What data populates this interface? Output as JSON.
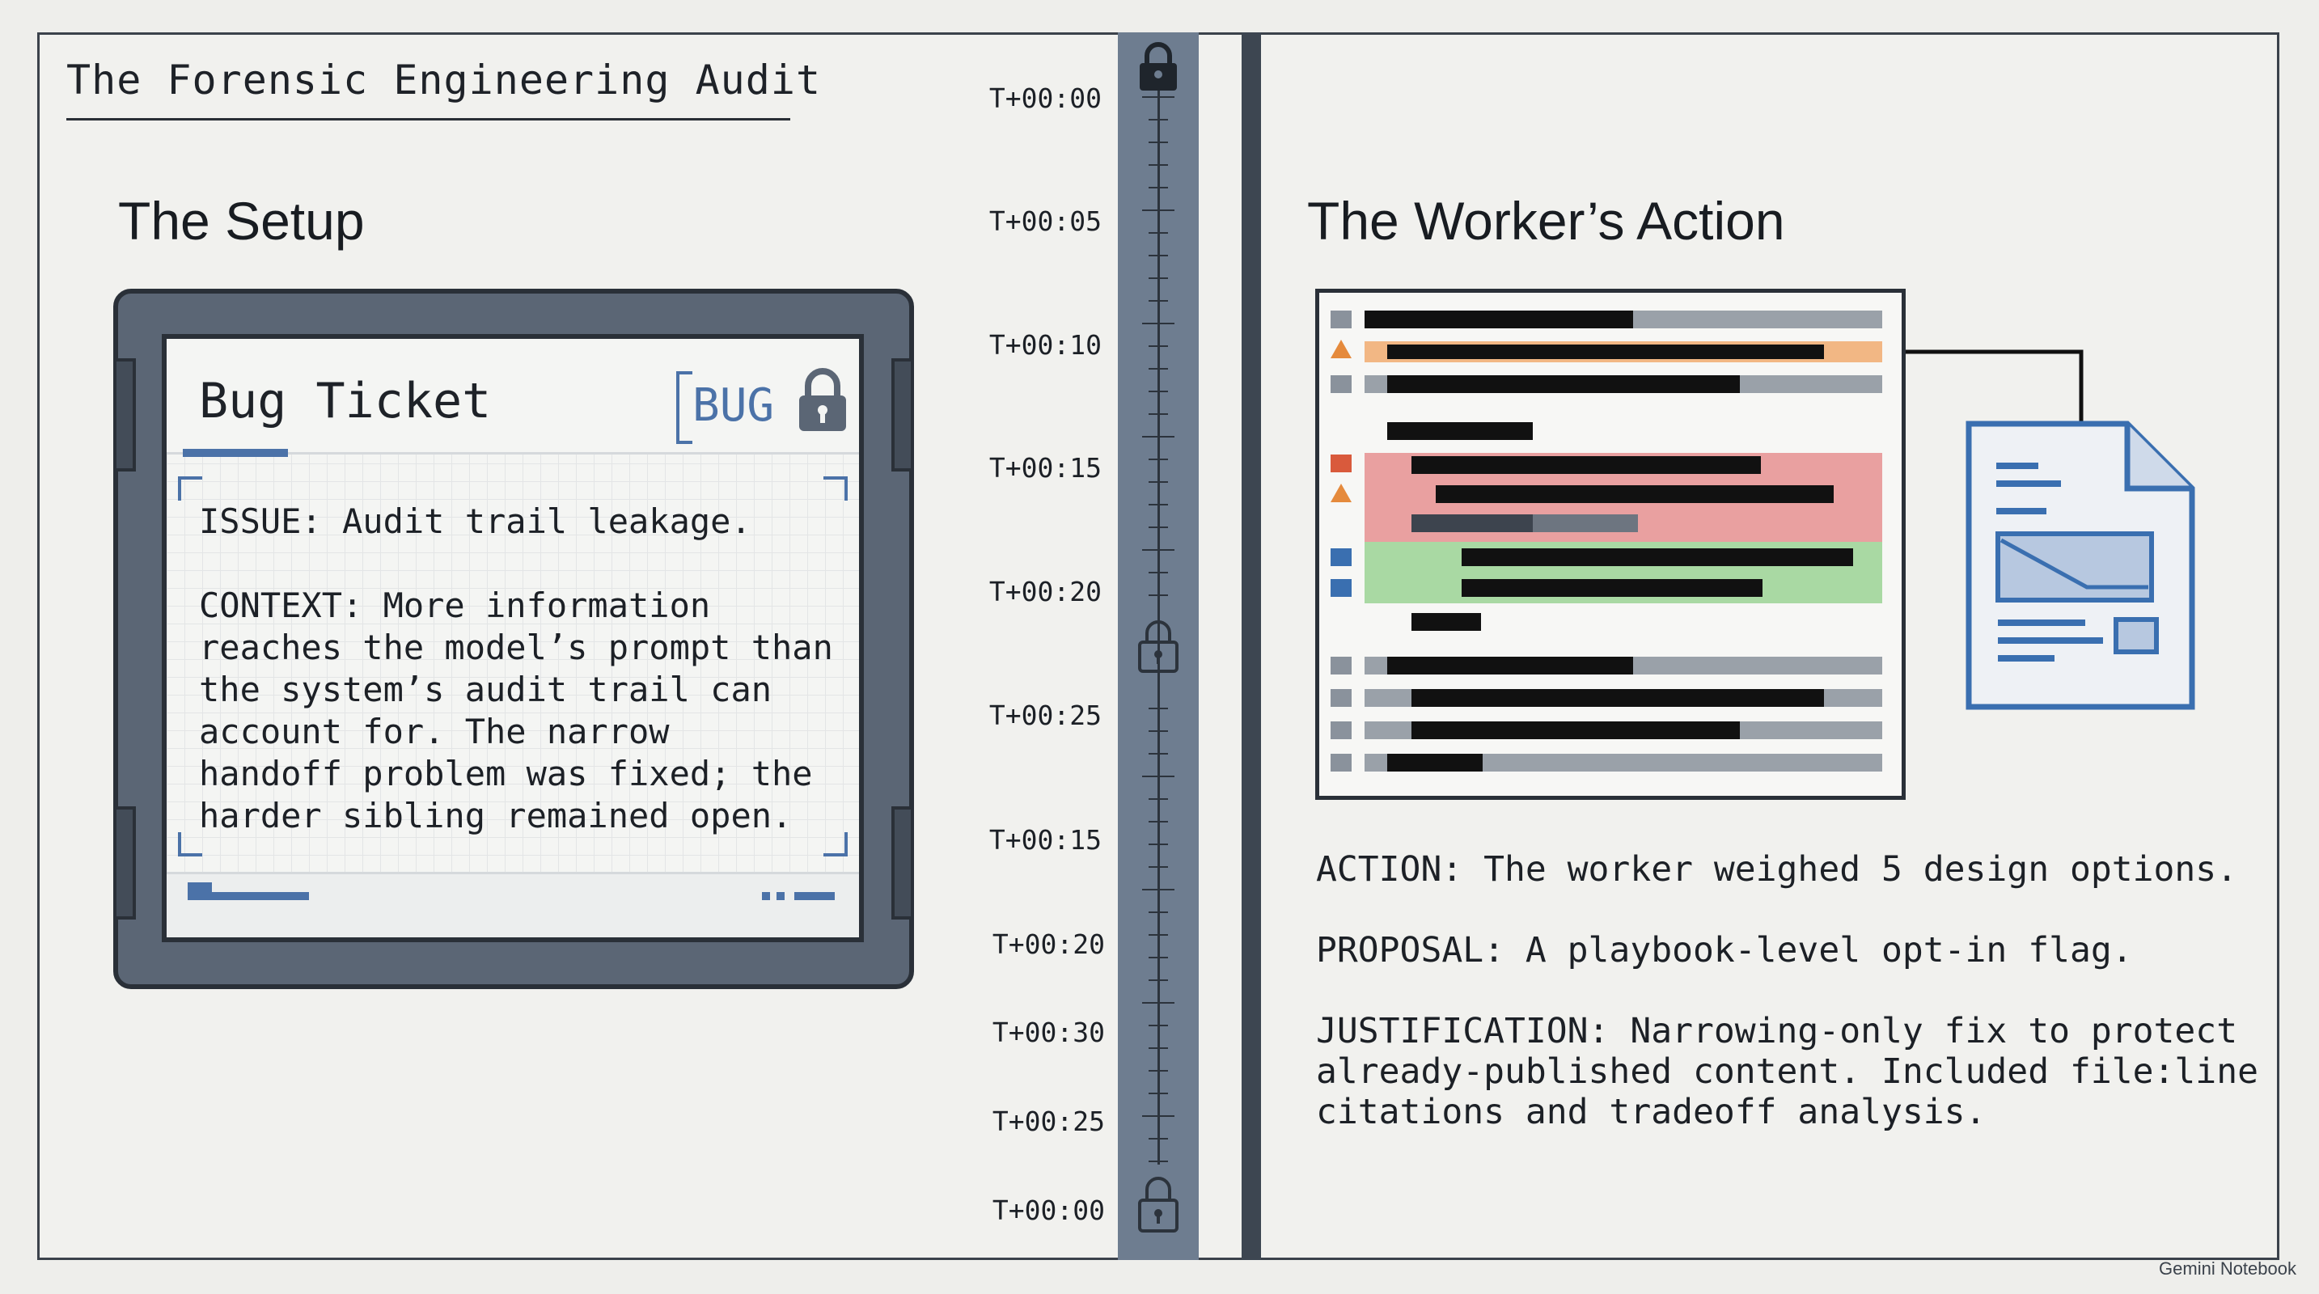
{
  "title": "The Forensic Engineering Audit",
  "setup": {
    "heading": "The Setup",
    "ticket": {
      "title": "Bug Ticket",
      "tag": "BUG",
      "issue": "ISSUE: Audit trail leakage.",
      "context": "CONTEXT: More information\nreaches the model’s prompt than\nthe system’s audit trail can\naccount for. The narrow\nhandoff problem was fixed; the\nharder sibling remained open."
    }
  },
  "timeline": {
    "labels": [
      "T+00:00",
      "T+00:05",
      "T+00:10",
      "T+00:15",
      "T+00:20",
      "T+00:25",
      "T+00:15",
      "T+00:20",
      "T+00:30",
      "T+00:25",
      "T+00:00"
    ]
  },
  "worker": {
    "heading": "The Worker’s Action",
    "action": "ACTION: The worker weighed 5 design options.",
    "proposal": "PROPOSAL: A playbook-level opt-in flag.",
    "justification": "JUSTIFICATION: Narrowing-only fix to protect\nalready-published content. Included file:line\ncitations and tradeoff analysis."
  },
  "colors": {
    "accent_blue": "#4b72a8",
    "warning_orange": "#e58a3c",
    "error_red": "#e9a0a0",
    "ok_green": "#a9d9a3",
    "timeline": "#6e7d90"
  },
  "watermark": "Gemini Notebook"
}
